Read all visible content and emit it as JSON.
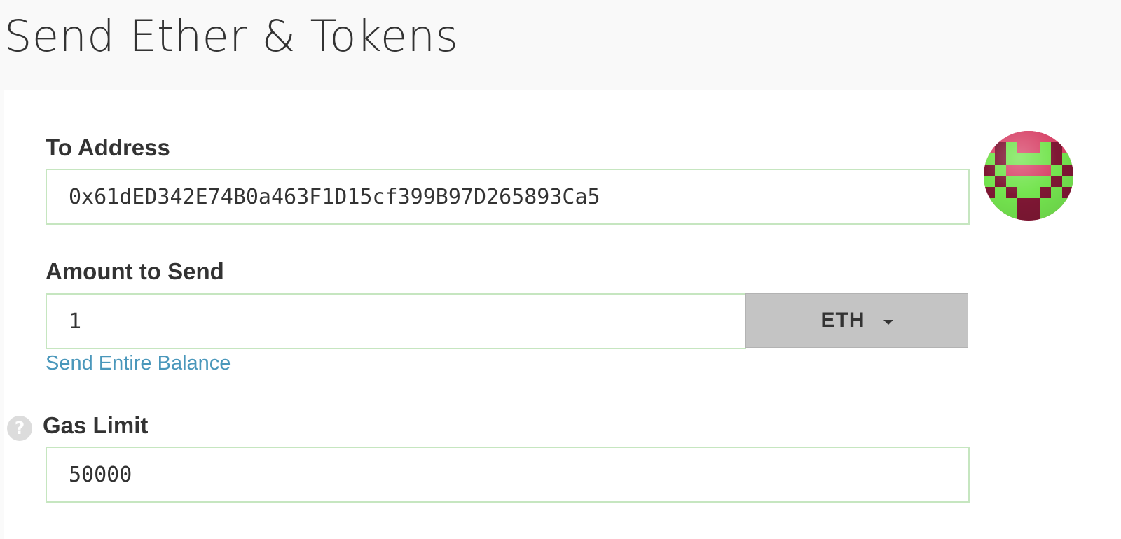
{
  "header": {
    "title": "Send Ether & Tokens"
  },
  "form": {
    "to_address": {
      "label": "To Address",
      "value": "0x61dED342E74B0a463F1D15cf399B97D265893Ca5",
      "avatar_icon": "address-identicon"
    },
    "amount": {
      "label": "Amount to Send",
      "value": "1",
      "unit": "ETH",
      "send_entire_balance_label": "Send Entire Balance"
    },
    "gas_limit": {
      "label": "Gas Limit",
      "value": "50000",
      "help_icon": "question-mark",
      "help_glyph": "?"
    }
  },
  "colors": {
    "input_border": "#c6e6c0",
    "link": "#4a97bb",
    "dropdown_bg": "#c4c4c4",
    "identicon_green": "#74e44f",
    "identicon_pink": "#d8466a",
    "identicon_dark": "#7f1734"
  }
}
